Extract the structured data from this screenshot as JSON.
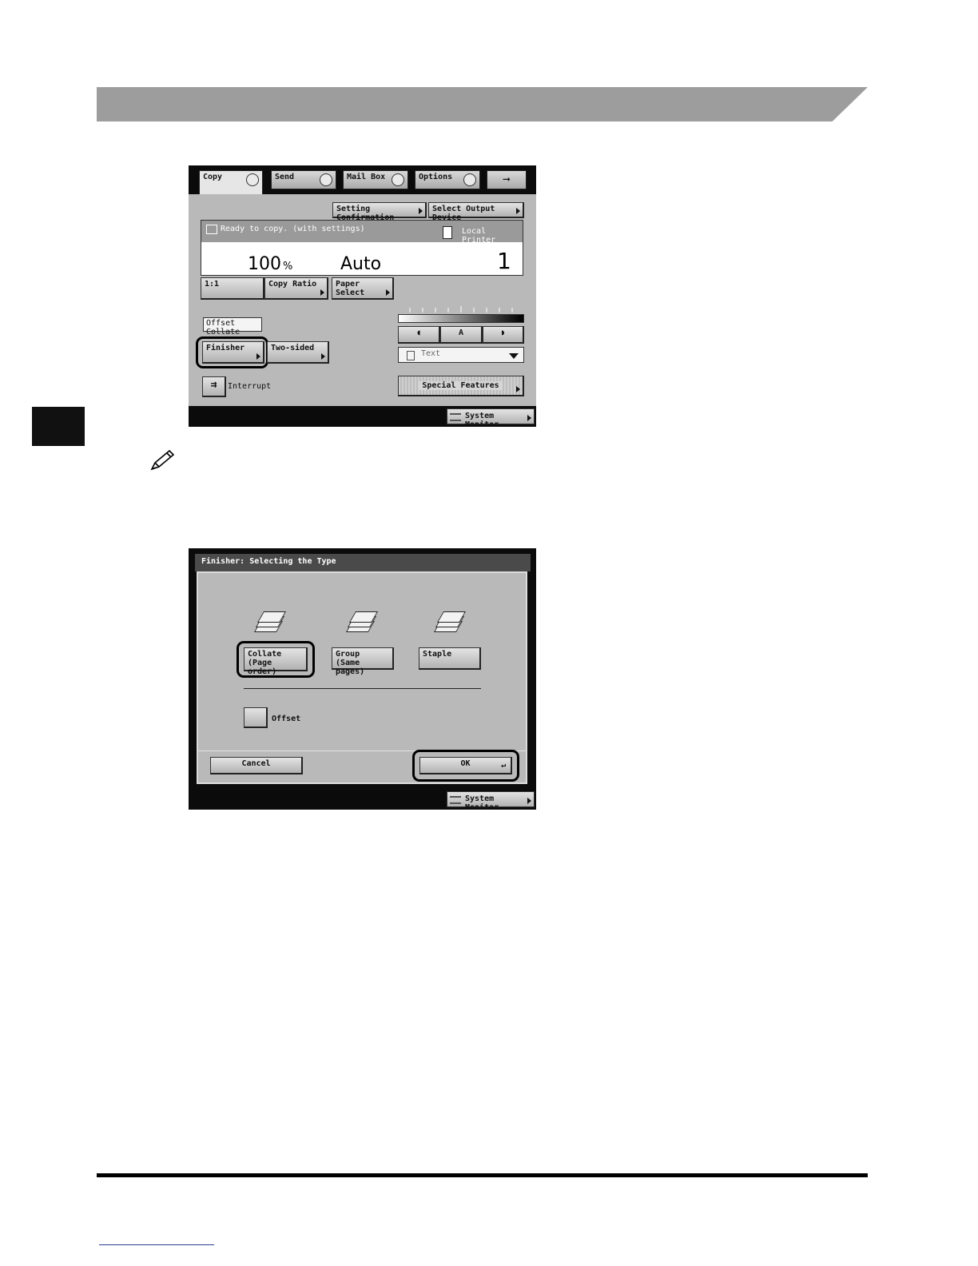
{
  "screen1": {
    "tabs": [
      {
        "label": "Copy",
        "icon": "copy-icon"
      },
      {
        "label": "Send",
        "icon": "send-icon"
      },
      {
        "label": "Mail Box",
        "icon": "mail-box-icon"
      },
      {
        "label": "Options",
        "icon": "options-icon"
      }
    ],
    "next_tab_icon": "right-arrow-icon",
    "setting_confirmation": "Setting Confirmation",
    "select_output_device": "Select Output Device",
    "status_message": "Ready to copy. (with settings)",
    "output_device": "Local Printer",
    "copy_ratio_value": "100",
    "percent_sign": "%",
    "paper_value": "Auto",
    "copy_count": "1",
    "ratio_preset": "1:1",
    "copy_ratio_label": "Copy Ratio",
    "paper_select_label": "Paper Select",
    "current_finishing": "Offset Collate",
    "finisher_label": "Finisher",
    "two_sided_label": "Two-sided",
    "density_auto_label": "A",
    "original_type": "Text",
    "interrupt_label": "Interrupt",
    "special_features_label": "Special Features",
    "system_monitor_label": "System Monitor"
  },
  "screen2": {
    "title": "Finisher: Selecting the Type",
    "options": [
      {
        "line1": "Collate",
        "line2": "(Page order)",
        "selected": true
      },
      {
        "line1": "Group",
        "line2": "(Same pages)",
        "selected": false
      },
      {
        "line1": "Staple",
        "line2": "",
        "selected": false
      }
    ],
    "offset_label": "Offset",
    "cancel_label": "Cancel",
    "ok_label": "OK",
    "system_monitor_label": "System Monitor"
  },
  "colors": {
    "section_bar": "#9d9d9d",
    "screen_bg": "#b9b9b9",
    "callout": "#000000"
  }
}
